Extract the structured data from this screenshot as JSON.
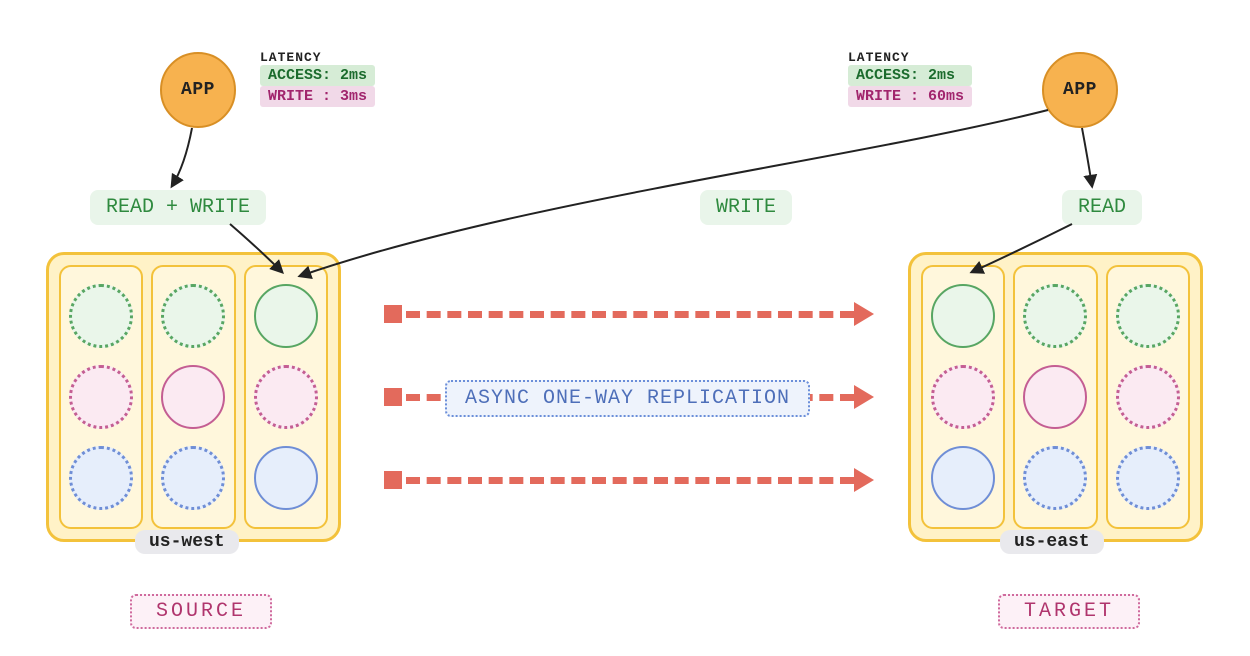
{
  "apps": {
    "left": {
      "label": "APP"
    },
    "right": {
      "label": "APP"
    }
  },
  "latency": {
    "title": "LATENCY",
    "left": {
      "access": "ACCESS: 2ms",
      "write": "WRITE : 3ms"
    },
    "right": {
      "access": "ACCESS: 2ms",
      "write": "WRITE : 60ms"
    }
  },
  "actions": {
    "left_rw": "READ + WRITE",
    "cross_write": "WRITE",
    "right_read": "READ"
  },
  "regions": {
    "left": {
      "name": "us-west"
    },
    "right": {
      "name": "us-east"
    }
  },
  "roles": {
    "left": "SOURCE",
    "right": "TARGET"
  },
  "replication": {
    "label": "ASYNC ONE-WAY REPLICATION"
  }
}
